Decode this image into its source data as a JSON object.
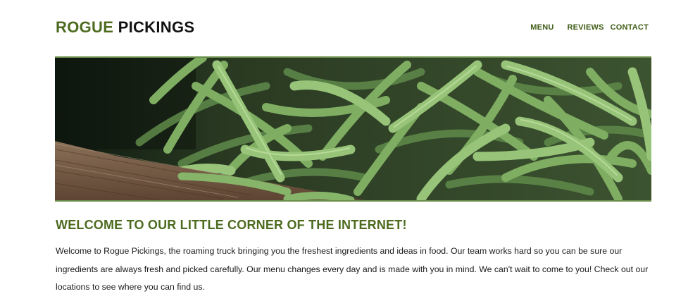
{
  "header": {
    "logo_accent": "ROGUE",
    "logo_rest": " PICKINGS",
    "nav": {
      "menu": "MENU",
      "reviews": "REVIEWS",
      "contact": "CONTACT"
    }
  },
  "hero": {
    "image_subject": "green beans in a wooden crate"
  },
  "main": {
    "title": "WELCOME TO OUR LITTLE CORNER OF THE INTERNET!",
    "body": "Welcome to Rogue Pickings, the roaming truck bringing you the freshest ingredients and ideas in food. Our team works hard so you can be sure our ingredients are always fresh and picked carefully. Our menu changes every day and is made with you in mind. We can't wait to come to you! Check out our locations to see where you can find us."
  },
  "colors": {
    "brand_green": "#4d6b1f",
    "nav_green": "#3f5c16",
    "hero_border": "#6a8e4a"
  }
}
